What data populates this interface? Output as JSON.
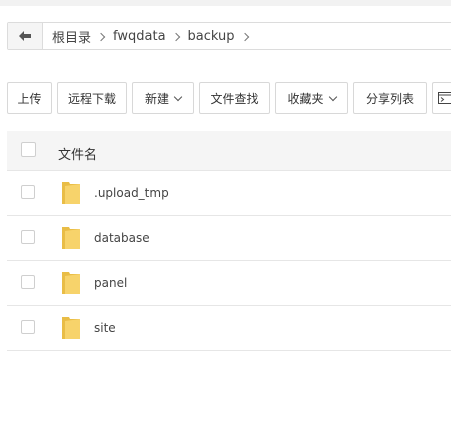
{
  "breadcrumb": {
    "segments": [
      "根目录",
      "fwqdata",
      "backup"
    ]
  },
  "toolbar": {
    "upload": "上传",
    "remote_download": "远程下载",
    "new": "新建",
    "file_search": "文件查找",
    "favorites": "收藏夹",
    "share_list": "分享列表"
  },
  "table": {
    "header_name": "文件名",
    "rows": [
      {
        "name": ".upload_tmp"
      },
      {
        "name": "database"
      },
      {
        "name": "panel"
      },
      {
        "name": "site"
      }
    ]
  },
  "colors": {
    "folder": "#f7d36b",
    "folder_dark": "#e9bd46",
    "border": "#dcdcdc",
    "header_bg": "#f5f5f5"
  }
}
